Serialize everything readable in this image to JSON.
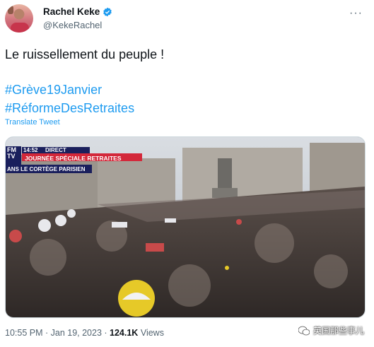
{
  "author": {
    "name": "Rachel Keke",
    "handle": "@KekeRachel"
  },
  "tweet": {
    "text": "Le ruissellement du peuple !",
    "hashtags": [
      "#Grève19Janvier",
      "#RéformeDesRetraites"
    ],
    "translate_label": "Translate Tweet"
  },
  "media": {
    "overlay_channel": "FM\nTV",
    "overlay_time": "14:52",
    "overlay_live": "DIRECT",
    "overlay_banner": "JOURNÉE SPÉCIALE RETRAITES",
    "overlay_sub": "ANS LE CORTÈGE PARISIEN"
  },
  "footer": {
    "time": "10:55 PM",
    "date": "Jan 19, 2023",
    "views_count": "124.1K",
    "views_label": "Views"
  },
  "watermark": {
    "text": "英国那些事儿"
  },
  "colors": {
    "accent": "#1d9bf0",
    "text": "#0f1419",
    "muted": "#536471"
  }
}
